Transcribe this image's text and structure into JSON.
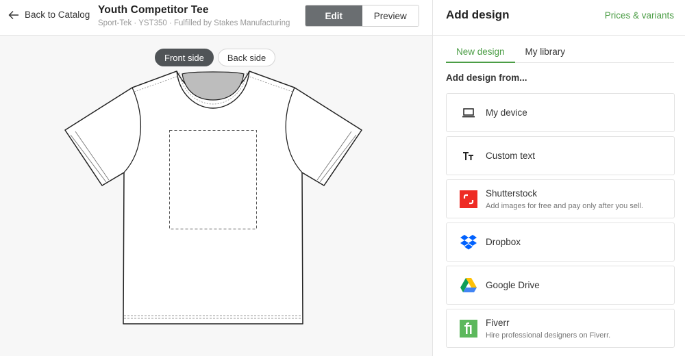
{
  "header": {
    "back_label": "Back to Catalog",
    "product_title": "Youth Competitor Tee",
    "product_subtitle": "Sport-Tek · YST350 · Fulfilled by Stakes Manufacturing",
    "mode_edit": "Edit",
    "mode_preview": "Preview",
    "active_mode": "Edit"
  },
  "canvas": {
    "side_front": "Front side",
    "side_back": "Back side",
    "active_side": "Front side",
    "shirt_color": "#ffffff"
  },
  "panel": {
    "title": "Add design",
    "prices_link": "Prices & variants",
    "tabs": [
      {
        "label": "New design",
        "active": true
      },
      {
        "label": "My library",
        "active": false
      }
    ],
    "section_label": "Add design from...",
    "sources": [
      {
        "name": "My device",
        "description": "",
        "icon": "laptop-icon"
      },
      {
        "name": "Custom text",
        "description": "",
        "icon": "text-icon"
      },
      {
        "name": "Shutterstock",
        "description": "Add images for free and pay only after you sell.",
        "icon": "shutterstock-icon"
      },
      {
        "name": "Dropbox",
        "description": "",
        "icon": "dropbox-icon"
      },
      {
        "name": "Google Drive",
        "description": "",
        "icon": "google-drive-icon"
      },
      {
        "name": "Fiverr",
        "description": "Hire professional designers on Fiverr.",
        "icon": "fiverr-icon"
      }
    ]
  },
  "colors": {
    "accent_green": "#4b9d45",
    "active_toggle": "#6a6e71",
    "shutterstock_red": "#ee2b24",
    "dropbox_blue": "#0061fe",
    "fiverr_green": "#5cb85c"
  }
}
